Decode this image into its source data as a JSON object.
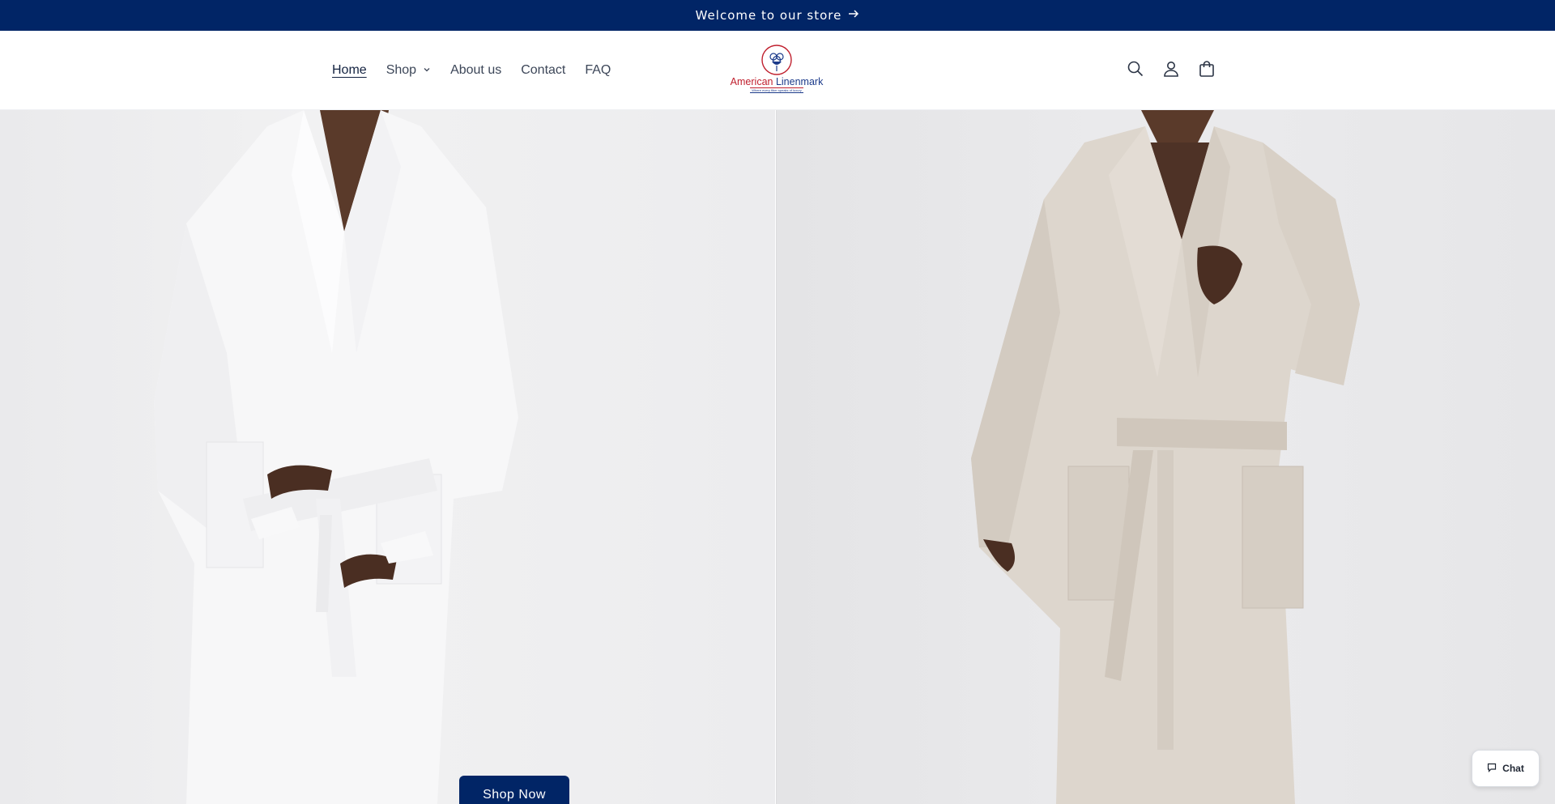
{
  "announcement": {
    "text": "Welcome to our store",
    "icon": "arrow-right-icon"
  },
  "nav": {
    "items": [
      {
        "label": "Home",
        "active": true
      },
      {
        "label": "Shop",
        "has_dropdown": true
      },
      {
        "label": "About us"
      },
      {
        "label": "Contact"
      },
      {
        "label": "FAQ"
      }
    ]
  },
  "logo": {
    "name_part1": "American",
    "name_part2": "Linenmark",
    "tagline": "Where every fiber speaks of luxury"
  },
  "header_icons": [
    "search-icon",
    "account-icon",
    "cart-icon"
  ],
  "hero": {
    "button_label": "Shop Now"
  },
  "chat": {
    "label": "Chat",
    "icon": "chat-bubble-icon"
  },
  "colors": {
    "brand_navy": "#012566",
    "logo_red": "#c0202e",
    "logo_blue": "#1b3a8a"
  }
}
